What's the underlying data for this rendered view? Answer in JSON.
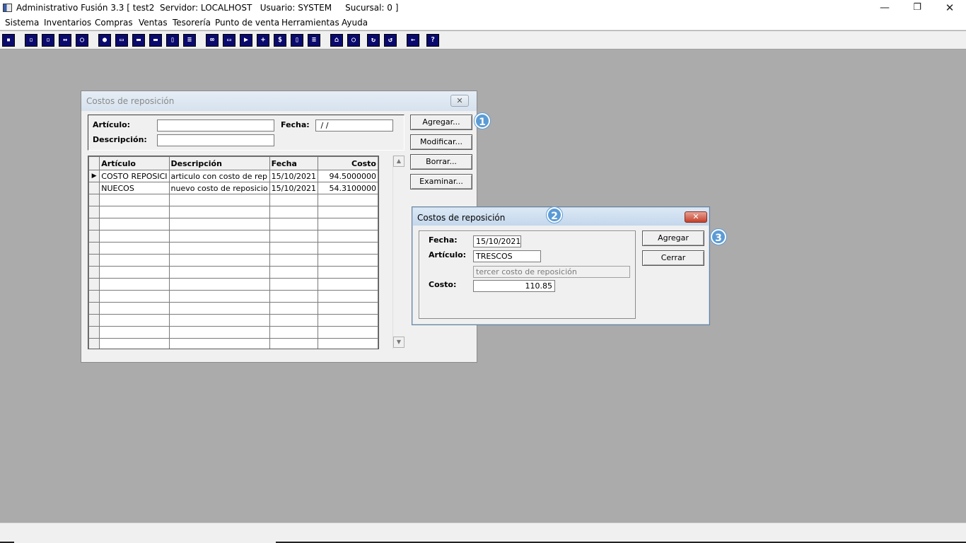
{
  "window": {
    "title": "Administrativo Fusión 3.3 [ test2  Servidor: LOCALHOST   Usuario: SYSTEM     Sucursal: 0 ]",
    "minimize": "—",
    "maximize": "❐",
    "close": "✕"
  },
  "menu": [
    "Sistema",
    "Inventarios",
    "Compras",
    "Ventas",
    "Tesorería",
    "Punto de venta",
    "Herramientas",
    "Ayuda"
  ],
  "toolbar_icons": [
    "calculator-icon",
    "copy-icon",
    "paste-icon",
    "transfer-icon",
    "zoom-icon",
    "user-icon",
    "folder-icon",
    "print-icon",
    "printer-icon",
    "document-icon",
    "list-icon",
    "binoculars-icon",
    "window-icon",
    "export-icon",
    "add-icon",
    "dollar-icon",
    "report-icon",
    "table-icon",
    "home-icon",
    "search-icon",
    "refresh-icon",
    "undo-icon",
    "back-icon",
    "help-icon"
  ],
  "costos": {
    "title": "Costos de reposición",
    "close": "✕",
    "articulo_label": "Artículo:",
    "descripcion_label": "Descripción:",
    "fecha_label": "Fecha:",
    "articulo_value": "",
    "descripcion_value": "",
    "fecha_value": " / /",
    "buttons": {
      "agregar": "Agregar...",
      "modificar": "Modificar...",
      "borrar": "Borrar...",
      "examinar": "Examinar..."
    },
    "grid": {
      "headers": [
        "Artículo",
        "Descripción",
        "Fecha",
        "Costo"
      ],
      "rows": [
        {
          "indicator": "▶",
          "articulo": "COSTO REPOSICI",
          "descripcion": "articulo con costo de rep",
          "fecha": "15/10/2021",
          "costo": "94.5000000"
        },
        {
          "indicator": "",
          "articulo": "NUECOS",
          "descripcion": "nuevo costo de reposicio",
          "fecha": "15/10/2021",
          "costo": "54.3100000"
        }
      ],
      "scroll_up": "▲",
      "scroll_down": "▼"
    }
  },
  "dialog": {
    "title": "Costos de reposición",
    "close": "✕",
    "fecha_label": "Fecha:",
    "fecha_value": "15/10/2021",
    "articulo_label": "Artículo:",
    "articulo_value": "TRESCOS",
    "descripcion_value": "tercer costo de reposición",
    "costo_label": "Costo:",
    "costo_value": "110.85",
    "agregar": "Agregar",
    "cerrar": "Cerrar"
  },
  "badges": [
    "1",
    "2",
    "3"
  ],
  "colors": {
    "desktop": "#ababab",
    "badge": "#5b9bd5",
    "close_red": "#c4402b"
  }
}
